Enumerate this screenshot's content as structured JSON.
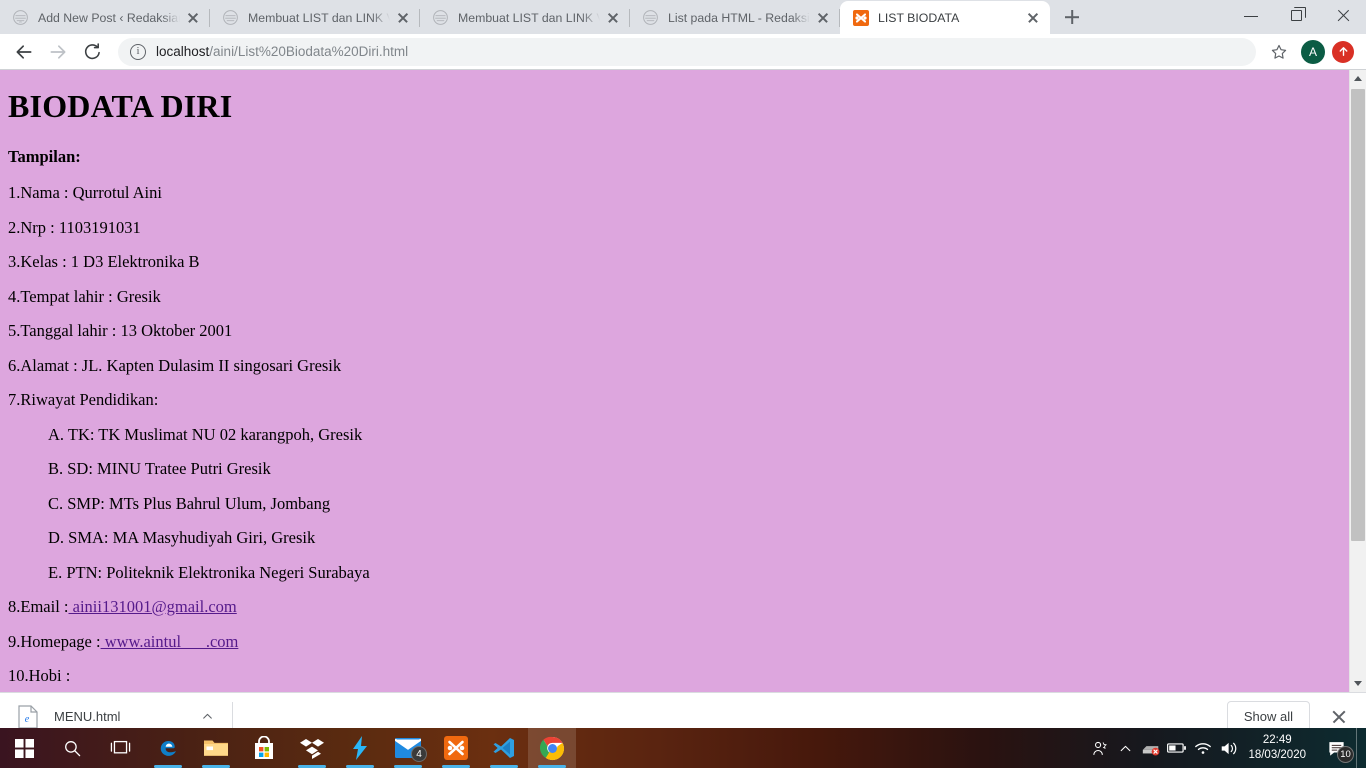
{
  "browser": {
    "tabs": [
      {
        "title": "Add New Post ‹ Redaksiana — ",
        "favicon": "wordpress-icon",
        "active": false
      },
      {
        "title": "Membuat LIST dan LINK Versi H",
        "favicon": "wordpress-icon",
        "active": false
      },
      {
        "title": "Membuat LIST dan LINK Versi H",
        "favicon": "wordpress-icon",
        "active": false
      },
      {
        "title": "List pada HTML - Redaksiana",
        "favicon": "wordpress-icon",
        "active": false
      },
      {
        "title": "LIST BIODATA",
        "favicon": "xampp-icon",
        "active": true
      }
    ],
    "new_tab_label": "+",
    "window_controls": {
      "minimize": "–",
      "maximize": "□",
      "close": "×"
    },
    "omnibox": {
      "scheme_text": "localhost",
      "path_text": "/aini/List%20Biodata%20Diri.html",
      "full_url": "localhost/aini/List%20Biodata%20Diri.html"
    },
    "profile_initial": "A"
  },
  "page": {
    "heading": "BIODATA DIRI",
    "subheading": "Tampilan:",
    "lines": [
      "1.Nama : Qurrotul Aini",
      "2.Nrp : 1103191031",
      "3.Kelas : 1 D3 Elektronika B",
      "4.Tempat lahir : Gresik",
      "5.Tanggal lahir : 13 Oktober 2001",
      "6.Alamat : JL. Kapten Dulasim II singosari Gresik",
      "7.Riwayat Pendidikan:"
    ],
    "education": [
      "A. TK: TK Muslimat NU 02 karangpoh, Gresik",
      "B. SD: MINU Tratee Putri Gresik",
      "C. SMP: MTs Plus Bahrul Ulum, Jombang",
      "D. SMA: MA Masyhudiyah Giri, Gresik",
      "E. PTN: Politeknik Elektronika Negeri Surabaya"
    ],
    "email_label": "8.Email :",
    "email_link": " ainii131001@gmail.com",
    "homepage_label": "9.Homepage :",
    "homepage_link": " www.aintul___.com",
    "hobby_label": "10.Hobi :",
    "background_color": "#dda6de",
    "link_color": "#551a8b"
  },
  "download_shelf": {
    "file_name": "MENU.html",
    "show_all_label": "Show all"
  },
  "taskbar": {
    "apps": [
      {
        "name": "start-button"
      },
      {
        "name": "search-button"
      },
      {
        "name": "task-view-button"
      },
      {
        "name": "edge-icon"
      },
      {
        "name": "file-explorer-icon"
      },
      {
        "name": "microsoft-store-icon"
      },
      {
        "name": "dropbox-icon"
      },
      {
        "name": "lightning-app-icon"
      },
      {
        "name": "mail-icon",
        "badge": "4"
      },
      {
        "name": "xampp-icon"
      },
      {
        "name": "vscode-icon"
      },
      {
        "name": "chrome-icon"
      }
    ],
    "tray": {
      "time": "22:49",
      "date": "18/03/2020",
      "notification_count": "10"
    }
  }
}
